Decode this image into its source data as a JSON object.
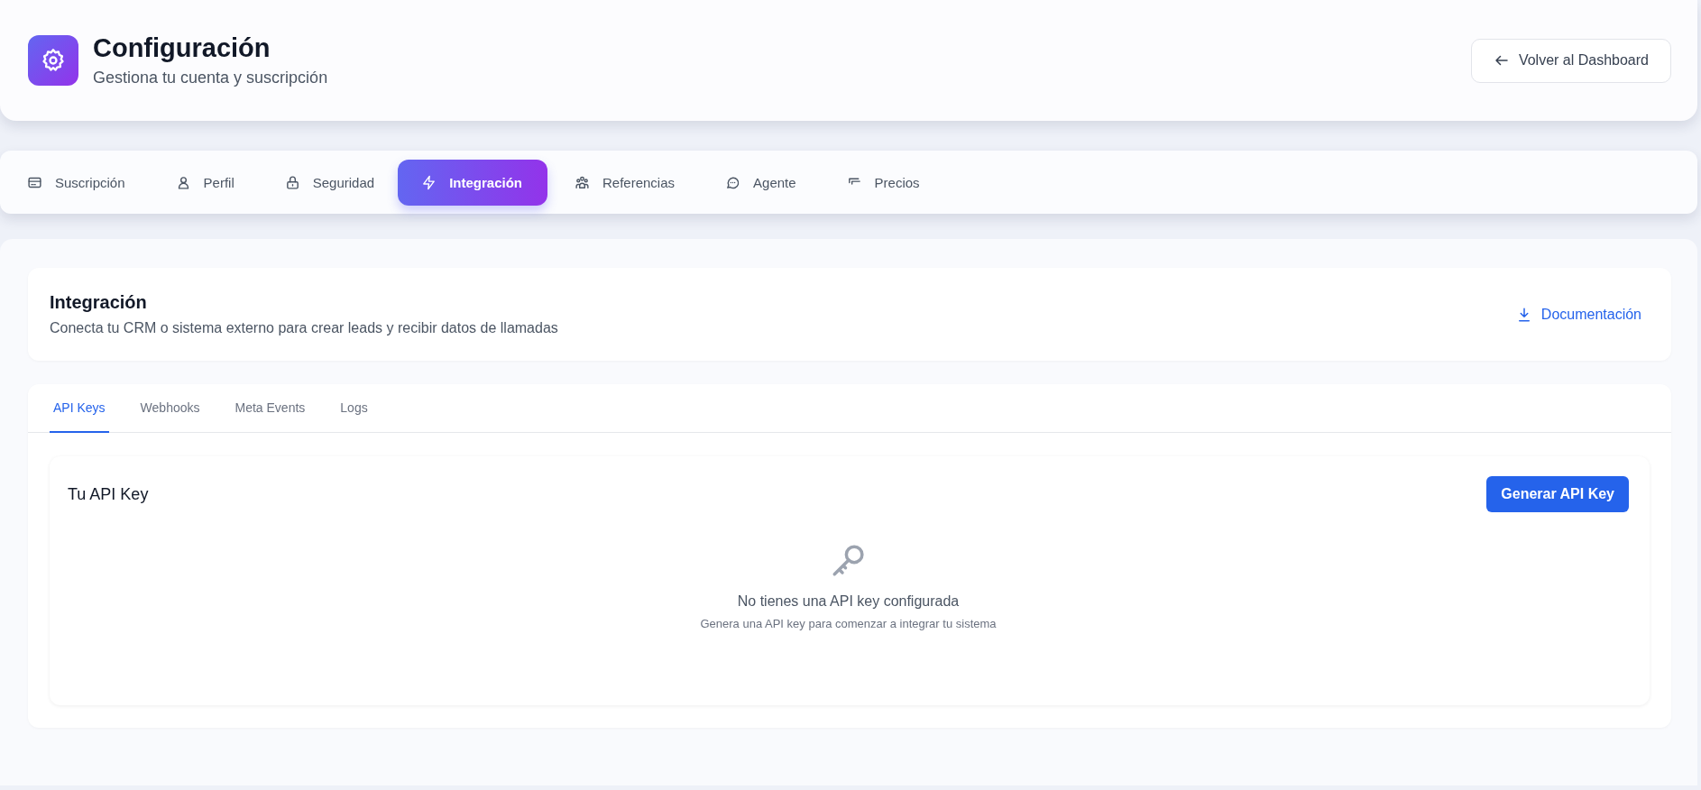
{
  "header": {
    "title": "Configuración",
    "subtitle": "Gestiona tu cuenta y suscripción",
    "back_button": "Volver al Dashboard"
  },
  "nav_tabs": [
    {
      "label": "Suscripción",
      "selected": false
    },
    {
      "label": "Perfil",
      "selected": false
    },
    {
      "label": "Seguridad",
      "selected": false
    },
    {
      "label": "Integración",
      "selected": true
    },
    {
      "label": "Referencias",
      "selected": false
    },
    {
      "label": "Agente",
      "selected": false
    },
    {
      "label": "Precios",
      "selected": false
    }
  ],
  "section": {
    "title": "Integración",
    "description": "Conecta tu CRM o sistema externo para crear leads y recibir datos de llamadas",
    "docs_link": "Documentación"
  },
  "sub_tabs": [
    {
      "label": "API Keys",
      "selected": true
    },
    {
      "label": "Webhooks",
      "selected": false
    },
    {
      "label": "Meta Events",
      "selected": false
    },
    {
      "label": "Logs",
      "selected": false
    }
  ],
  "api_key_card": {
    "title": "Tu API Key",
    "generate_button": "Generar API Key",
    "empty_title": "No tienes una API key configurada",
    "empty_description": "Genera una API key para comenzar a integrar tu sistema"
  }
}
